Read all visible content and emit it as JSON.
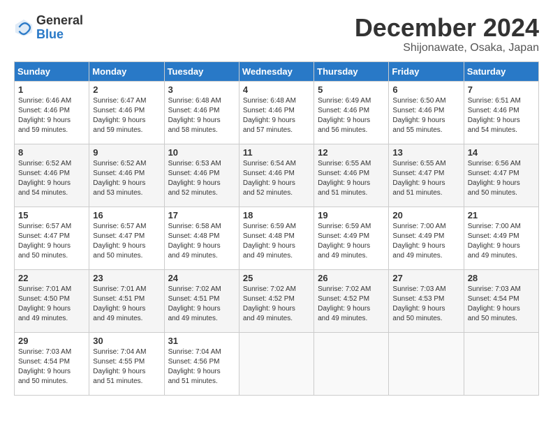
{
  "logo": {
    "general": "General",
    "blue": "Blue"
  },
  "title": "December 2024",
  "location": "Shijonawate, Osaka, Japan",
  "days_of_week": [
    "Sunday",
    "Monday",
    "Tuesday",
    "Wednesday",
    "Thursday",
    "Friday",
    "Saturday"
  ],
  "weeks": [
    [
      {
        "day": "1",
        "sunrise": "6:46 AM",
        "sunset": "4:46 PM",
        "daylight": "9 hours and 59 minutes."
      },
      {
        "day": "2",
        "sunrise": "6:47 AM",
        "sunset": "4:46 PM",
        "daylight": "9 hours and 59 minutes."
      },
      {
        "day": "3",
        "sunrise": "6:48 AM",
        "sunset": "4:46 PM",
        "daylight": "9 hours and 58 minutes."
      },
      {
        "day": "4",
        "sunrise": "6:48 AM",
        "sunset": "4:46 PM",
        "daylight": "9 hours and 57 minutes."
      },
      {
        "day": "5",
        "sunrise": "6:49 AM",
        "sunset": "4:46 PM",
        "daylight": "9 hours and 56 minutes."
      },
      {
        "day": "6",
        "sunrise": "6:50 AM",
        "sunset": "4:46 PM",
        "daylight": "9 hours and 55 minutes."
      },
      {
        "day": "7",
        "sunrise": "6:51 AM",
        "sunset": "4:46 PM",
        "daylight": "9 hours and 54 minutes."
      }
    ],
    [
      {
        "day": "8",
        "sunrise": "6:52 AM",
        "sunset": "4:46 PM",
        "daylight": "9 hours and 54 minutes."
      },
      {
        "day": "9",
        "sunrise": "6:52 AM",
        "sunset": "4:46 PM",
        "daylight": "9 hours and 53 minutes."
      },
      {
        "day": "10",
        "sunrise": "6:53 AM",
        "sunset": "4:46 PM",
        "daylight": "9 hours and 52 minutes."
      },
      {
        "day": "11",
        "sunrise": "6:54 AM",
        "sunset": "4:46 PM",
        "daylight": "9 hours and 52 minutes."
      },
      {
        "day": "12",
        "sunrise": "6:55 AM",
        "sunset": "4:46 PM",
        "daylight": "9 hours and 51 minutes."
      },
      {
        "day": "13",
        "sunrise": "6:55 AM",
        "sunset": "4:47 PM",
        "daylight": "9 hours and 51 minutes."
      },
      {
        "day": "14",
        "sunrise": "6:56 AM",
        "sunset": "4:47 PM",
        "daylight": "9 hours and 50 minutes."
      }
    ],
    [
      {
        "day": "15",
        "sunrise": "6:57 AM",
        "sunset": "4:47 PM",
        "daylight": "9 hours and 50 minutes."
      },
      {
        "day": "16",
        "sunrise": "6:57 AM",
        "sunset": "4:47 PM",
        "daylight": "9 hours and 50 minutes."
      },
      {
        "day": "17",
        "sunrise": "6:58 AM",
        "sunset": "4:48 PM",
        "daylight": "9 hours and 49 minutes."
      },
      {
        "day": "18",
        "sunrise": "6:59 AM",
        "sunset": "4:48 PM",
        "daylight": "9 hours and 49 minutes."
      },
      {
        "day": "19",
        "sunrise": "6:59 AM",
        "sunset": "4:49 PM",
        "daylight": "9 hours and 49 minutes."
      },
      {
        "day": "20",
        "sunrise": "7:00 AM",
        "sunset": "4:49 PM",
        "daylight": "9 hours and 49 minutes."
      },
      {
        "day": "21",
        "sunrise": "7:00 AM",
        "sunset": "4:49 PM",
        "daylight": "9 hours and 49 minutes."
      }
    ],
    [
      {
        "day": "22",
        "sunrise": "7:01 AM",
        "sunset": "4:50 PM",
        "daylight": "9 hours and 49 minutes."
      },
      {
        "day": "23",
        "sunrise": "7:01 AM",
        "sunset": "4:51 PM",
        "daylight": "9 hours and 49 minutes."
      },
      {
        "day": "24",
        "sunrise": "7:02 AM",
        "sunset": "4:51 PM",
        "daylight": "9 hours and 49 minutes."
      },
      {
        "day": "25",
        "sunrise": "7:02 AM",
        "sunset": "4:52 PM",
        "daylight": "9 hours and 49 minutes."
      },
      {
        "day": "26",
        "sunrise": "7:02 AM",
        "sunset": "4:52 PM",
        "daylight": "9 hours and 49 minutes."
      },
      {
        "day": "27",
        "sunrise": "7:03 AM",
        "sunset": "4:53 PM",
        "daylight": "9 hours and 50 minutes."
      },
      {
        "day": "28",
        "sunrise": "7:03 AM",
        "sunset": "4:54 PM",
        "daylight": "9 hours and 50 minutes."
      }
    ],
    [
      {
        "day": "29",
        "sunrise": "7:03 AM",
        "sunset": "4:54 PM",
        "daylight": "9 hours and 50 minutes."
      },
      {
        "day": "30",
        "sunrise": "7:04 AM",
        "sunset": "4:55 PM",
        "daylight": "9 hours and 51 minutes."
      },
      {
        "day": "31",
        "sunrise": "7:04 AM",
        "sunset": "4:56 PM",
        "daylight": "9 hours and 51 minutes."
      },
      null,
      null,
      null,
      null
    ]
  ]
}
